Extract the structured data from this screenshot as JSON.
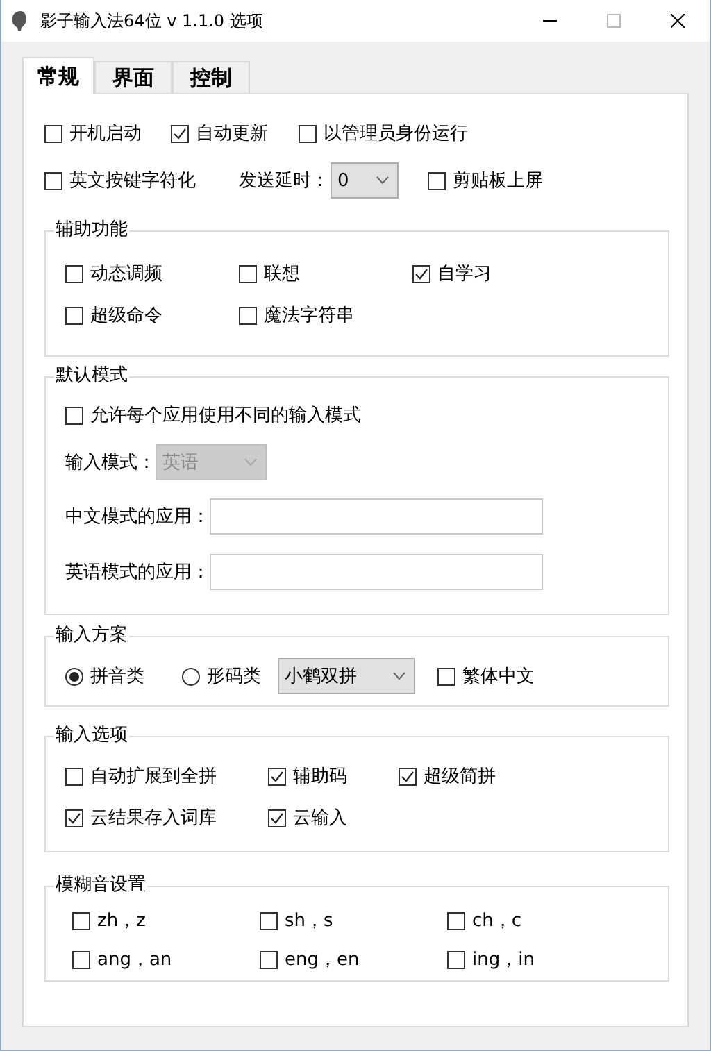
{
  "window": {
    "title": "影子输入法64位 v 1.1.0 选项"
  },
  "tabs": [
    {
      "label": "常规",
      "selected": true
    },
    {
      "label": "界面",
      "selected": false
    },
    {
      "label": "控制",
      "selected": false
    }
  ],
  "top_rows": [
    [
      {
        "kind": "checkbox",
        "label": "开机启动",
        "checked": false
      },
      {
        "kind": "checkbox",
        "label": "自动更新",
        "checked": true
      },
      {
        "kind": "checkbox",
        "label": "以管理员身份运行",
        "checked": false
      }
    ],
    [
      {
        "kind": "checkbox",
        "label": "英文按键字符化",
        "checked": false
      },
      {
        "kind": "dropdown",
        "label": "发送延时：",
        "value": "0",
        "disabled": false
      },
      {
        "kind": "checkbox",
        "label": "剪贴板上屏",
        "checked": false
      }
    ]
  ],
  "groups": [
    {
      "title": "辅助功能",
      "rows": [
        [
          {
            "kind": "checkbox",
            "label": "动态调频",
            "checked": false
          },
          {
            "kind": "checkbox",
            "label": "联想",
            "checked": false
          },
          {
            "kind": "checkbox",
            "label": "自学习",
            "checked": true
          }
        ],
        [
          {
            "kind": "checkbox",
            "label": "超级命令",
            "checked": false
          },
          {
            "kind": "checkbox",
            "label": "魔法字符串",
            "checked": false
          }
        ]
      ]
    },
    {
      "title": "默认模式",
      "rows": [
        [
          {
            "kind": "checkbox",
            "label": "允许每个应用使用不同的输入模式",
            "checked": false
          }
        ],
        [
          {
            "kind": "dropdown",
            "label": "输入模式：",
            "value": "英语",
            "disabled": true
          }
        ],
        [
          {
            "kind": "text_field",
            "label": "中文模式的应用："
          }
        ],
        [
          {
            "kind": "text_field",
            "label": "英语模式的应用："
          }
        ]
      ]
    },
    {
      "title": "输入方案",
      "rows": [
        [
          {
            "kind": "radio",
            "label": "拼音类",
            "selected": true
          },
          {
            "kind": "radio",
            "label": "形码类",
            "selected": false
          },
          {
            "kind": "dropdown",
            "value": "小鹤双拼",
            "disabled": false
          },
          {
            "kind": "checkbox",
            "label": "繁体中文",
            "checked": false
          }
        ]
      ]
    },
    {
      "title": "输入选项",
      "rows": [
        [
          {
            "kind": "checkbox",
            "label": "自动扩展到全拼",
            "checked": false
          },
          {
            "kind": "checkbox",
            "label": "辅助码",
            "checked": true
          },
          {
            "kind": "checkbox",
            "label": "超级简拼",
            "checked": true
          }
        ],
        [
          {
            "kind": "checkbox",
            "label": "云结果存入词库",
            "checked": true
          },
          {
            "kind": "checkbox",
            "label": "云输入",
            "checked": true
          }
        ]
      ]
    },
    {
      "title": "模糊音设置",
      "rows": [
        [
          {
            "kind": "checkbox",
            "label": "zh，z",
            "checked": false
          },
          {
            "kind": "checkbox",
            "label": "sh，s",
            "checked": false
          },
          {
            "kind": "checkbox",
            "label": "ch，c",
            "checked": false
          }
        ],
        [
          {
            "kind": "checkbox",
            "label": "ang，an",
            "checked": false
          },
          {
            "kind": "checkbox",
            "label": "eng，en",
            "checked": false
          },
          {
            "kind": "checkbox",
            "label": "ing，in",
            "checked": false
          }
        ]
      ]
    }
  ]
}
